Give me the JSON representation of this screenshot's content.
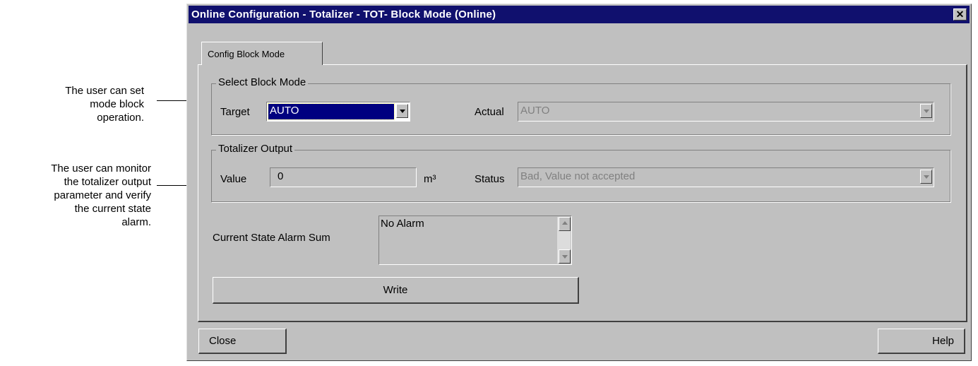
{
  "annotations": {
    "mode_note": [
      "The user can set",
      "mode block",
      "operation."
    ],
    "output_note": [
      "The user can monitor",
      "the totalizer output",
      "parameter and verify",
      "the current state",
      "alarm."
    ]
  },
  "window": {
    "title": "Online Configuration - Totalizer - TOT- Block Mode  (Online)",
    "close_glyph": "✕"
  },
  "tabs": [
    {
      "label": "Config Block Mode",
      "active": true
    }
  ],
  "block_mode": {
    "group_title": "Select Block Mode",
    "target_label": "Target",
    "target_value": "AUTO",
    "actual_label": "Actual",
    "actual_value": "AUTO"
  },
  "totalizer_output": {
    "group_title": "Totalizer Output",
    "value_label": "Value",
    "value": "0",
    "unit": "m³",
    "status_label": "Status",
    "status_value": "Bad, Value not accepted"
  },
  "alarm": {
    "label": "Current State Alarm Sum",
    "value": "No Alarm"
  },
  "buttons": {
    "write": "Write",
    "close": "Close",
    "help": "Help"
  },
  "colors": {
    "titlebar": "#10106e",
    "window_bg": "#c0c0c0",
    "selection": "#000080"
  }
}
